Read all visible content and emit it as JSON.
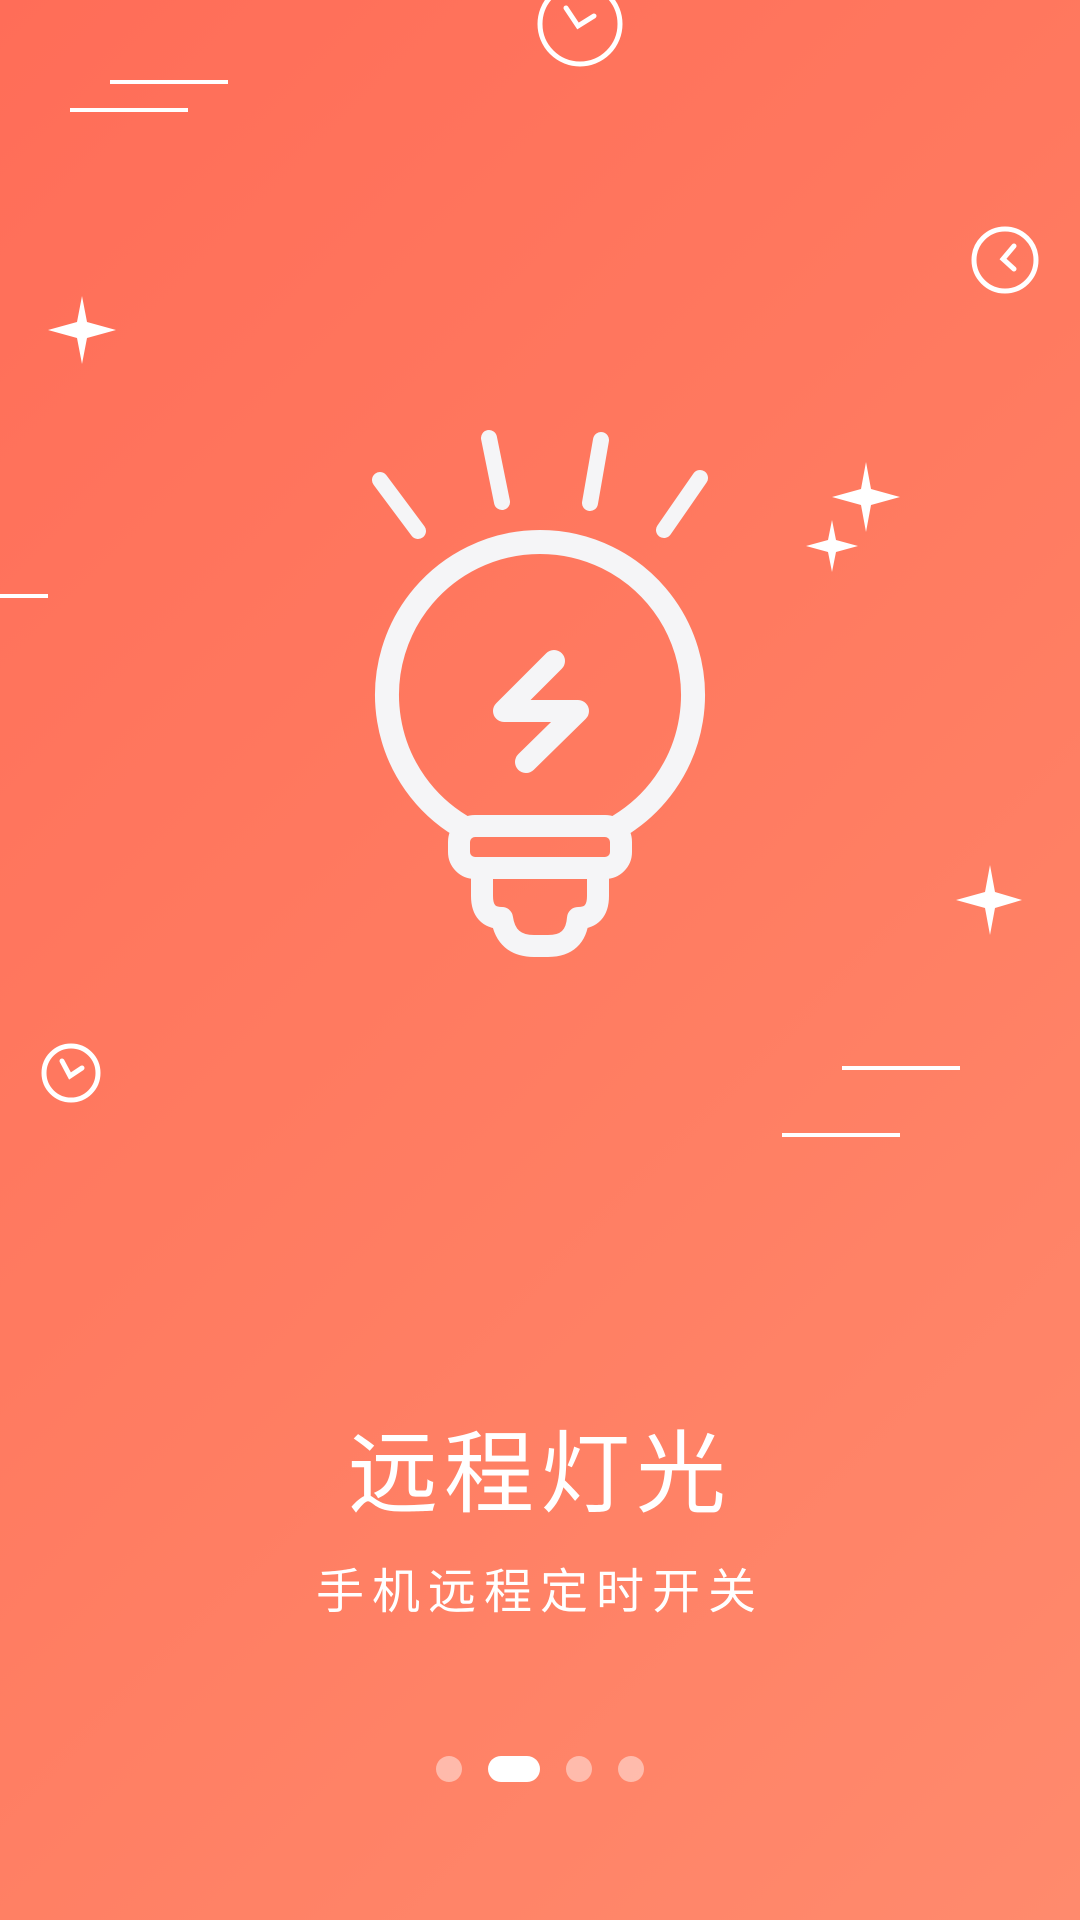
{
  "onboarding": {
    "title": "远程灯光",
    "subtitle": "手机远程定时开关"
  },
  "pager": {
    "total_pages": 4,
    "current_page": 2
  },
  "illustration": {
    "main_icon": "light-bulb-bolt-icon",
    "decorations": [
      "clock-icon",
      "sparkle-icon",
      "dash-line"
    ]
  },
  "colors": {
    "background_start": "#ff6d58",
    "background_end": "#ff8a6d",
    "foreground": "#ffffff",
    "bulb_stroke": "#f5f5f7"
  }
}
